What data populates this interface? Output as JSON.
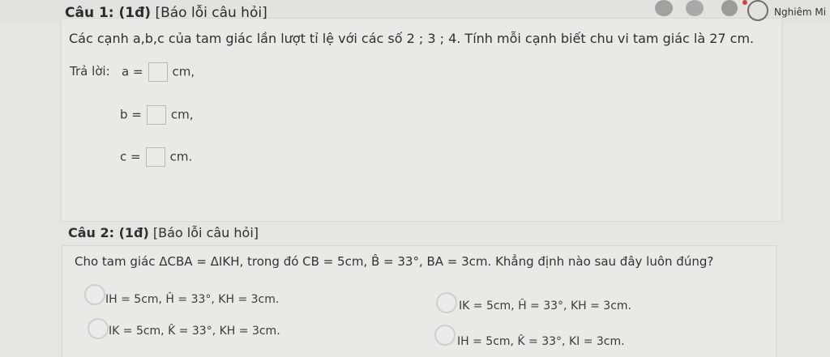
{
  "header": {
    "q1_title_bold": "Câu 1: (1đ)",
    "q1_title_rest": " [Báo lỗi câu hỏi]",
    "user_name": "Nghiêm Mi"
  },
  "question1": {
    "text": "Các cạnh a,b,c của tam giác lần lượt tỉ lệ với các số 2 ; 3 ; 4. Tính mỗi cạnh biết chu vi tam giác là 27 cm.",
    "answer_label": "Trả lời:",
    "rows": [
      {
        "var": "a =",
        "unit": "cm,"
      },
      {
        "var": "b =",
        "unit": "cm,"
      },
      {
        "var": "c =",
        "unit": "cm."
      }
    ]
  },
  "question2": {
    "title_bold": "Câu 2: (1đ)",
    "title_rest": " [Báo lỗi câu hỏi]",
    "text": "Cho tam giác ΔCBA = ΔIKH, trong đó CB = 5cm, B̂ = 33°, BA = 3cm. Khẳng định nào sau đây luôn đúng?",
    "options": [
      "IH = 5cm, Ĥ = 33°, KH = 3cm.",
      "IK = 5cm, Ĥ = 33°, KH = 3cm.",
      "IK = 5cm, K̂ = 33°, KH = 3cm.",
      "IH = 5cm, K̂ = 33°, KI = 3cm."
    ]
  },
  "icons": [
    "avatar-icon-1",
    "avatar-icon-2",
    "avatar-icon-3",
    "profile-icon"
  ]
}
